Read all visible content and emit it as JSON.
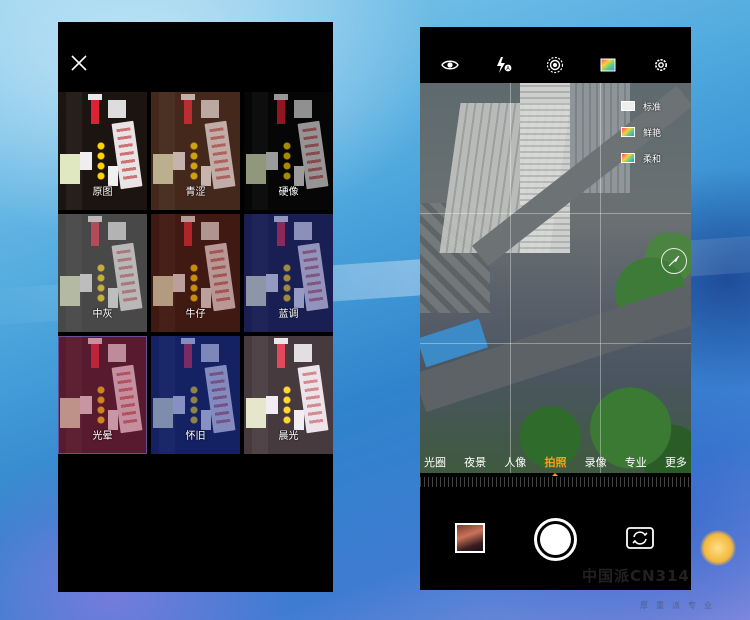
{
  "filter_screen": {
    "close_icon": "close-icon",
    "filters": [
      {
        "label": "原图",
        "tint": "rgba(0,0,0,0)",
        "base": "#1c1410"
      },
      {
        "label": "青涩",
        "tint": "rgba(120,70,50,0.35)",
        "base": "#2a1a12"
      },
      {
        "label": "硬像",
        "tint": "rgba(0,0,0,0.35)",
        "base": "#0a0a0a"
      },
      {
        "label": "中灰",
        "tint": "rgba(128,128,128,0.45)",
        "base": "#1a1a1a"
      },
      {
        "label": "牛仔",
        "tint": "rgba(110,40,30,0.4)",
        "base": "#22100c"
      },
      {
        "label": "蓝调",
        "tint": "rgba(40,50,140,0.45)",
        "base": "#0e0f25"
      },
      {
        "label": "光晕",
        "tint": "rgba(150,40,70,0.45)",
        "base": "#25101a",
        "selected": true
      },
      {
        "label": "怀旧",
        "tint": "rgba(30,50,150,0.5)",
        "base": "#0a1030"
      },
      {
        "label": "晨光",
        "tint": "rgba(255,230,255,0.2)",
        "base": "#1a1010"
      }
    ]
  },
  "camera_screen": {
    "toolbar_icons": [
      "eye-icon",
      "flash-auto-icon",
      "live-photo-icon",
      "color-filter-icon",
      "gear-icon"
    ],
    "color_modes": [
      {
        "label": "标准",
        "swatch": "#eeeeee"
      },
      {
        "label": "鲜艳",
        "swatch": "#e04b7a"
      },
      {
        "label": "柔和",
        "swatch": "#8cd6a8"
      }
    ],
    "modes": [
      "光圈",
      "夜景",
      "人像",
      "拍照",
      "录像",
      "专业",
      "更多"
    ],
    "active_mode": "拍照",
    "accent_color": "#ff9a1f"
  },
  "watermark": {
    "text": "中国派CN314",
    "subtext": "厚重派专业"
  }
}
